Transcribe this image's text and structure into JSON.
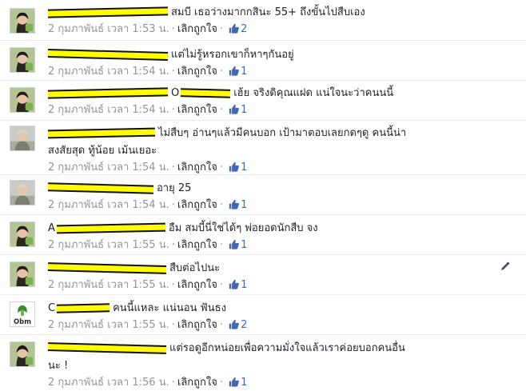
{
  "comments": [
    {
      "text": "สมบี เธอว่างมากกสินะ 55+ ถึงขั้นไปสืบเอง",
      "time": "2 กุมภาพันธ์ เวลา 1:53 น.",
      "unlike": "เลิกถูกใจ",
      "likes": "2",
      "avatar": "woman"
    },
    {
      "text": "แต่ไม่รู้หรอกเขาก็หาๆกันอยู่",
      "time": "2 กุมภาพันธ์ เวลา 1:54 น.",
      "unlike": "เลิกถูกใจ",
      "likes": "1",
      "avatar": "woman"
    },
    {
      "prefix": "O",
      "text": "เฮ้ย จริงดิคุณแฝด แน่ใจนะว่าคนนนี้",
      "time": "2 กุมภาพันธ์ เวลา 1:54 น.",
      "unlike": "เลิกถูกใจ",
      "likes": "1",
      "avatar": "woman"
    },
    {
      "text": "ไม่สืบๆ อ่านๆแล้วมีคนบอก เป้ามาตอบเลยกดๆดู คนนี้น่า",
      "text2": "สงสัยสุด ทู้น้อย เม้นเยอะ",
      "time": "2 กุมภาพันธ์ เวลา 1:54 น.",
      "unlike": "เลิกถูกใจ",
      "likes": "1",
      "avatar": "man"
    },
    {
      "text": "อายุ 25",
      "time": "2 กุมภาพันธ์ เวลา 1:54 น.",
      "unlike": "เลิกถูกใจ",
      "likes": "1",
      "avatar": "man"
    },
    {
      "prefix": "A",
      "text": "อืม สมบี้นี่ใช่ได้ๆ พ่อยอดนักสืบ จง",
      "time": "2 กุมภาพันธ์ เวลา 1:55 น.",
      "unlike": "เลิกถูกใจ",
      "likes": "1",
      "avatar": "woman"
    },
    {
      "text": "สืบต่อไปนะ",
      "time": "2 กุมภาพันธ์ เวลา 1:55 น.",
      "unlike": "เลิกถูกใจ",
      "likes": "1",
      "avatar": "woman"
    },
    {
      "prefix": "C",
      "text": "คนนี้แหละ แน่นอน ฟันธง",
      "time": "2 กุมภาพันธ์ เวลา 1:55 น.",
      "unlike": "เลิกถูกใจ",
      "likes": "2",
      "avatar": "logo",
      "logo_text": "Obm"
    },
    {
      "text": "แต่รอดูอีกหน่อยเพื่อความมั่งใจแล้วเราค่อยบอกคนอื่น",
      "text2": "นะ !",
      "time": "2 กุมภาพันธ์ เวลา 1:56 น.",
      "unlike": "เลิกถูกใจ",
      "likes": "1",
      "avatar": "woman"
    }
  ],
  "icons": {
    "like": "thumbs-up-icon",
    "edit": "pencil-icon"
  },
  "colors": {
    "link": "#4267b2",
    "meta": "#90949c",
    "redact": "#fffb00"
  }
}
